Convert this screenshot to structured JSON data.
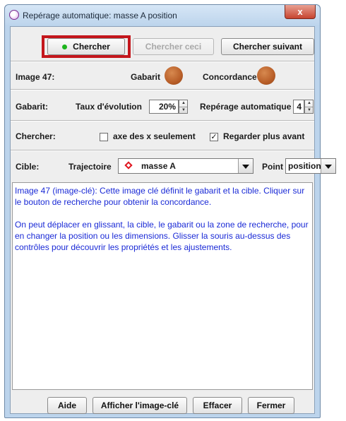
{
  "window": {
    "title": "Repérage automatique: masse A position",
    "close_label": "x"
  },
  "toolbar": {
    "search_label": "Chercher",
    "search_this_label": "Chercher ceci",
    "search_next_label": "Chercher suivant"
  },
  "image_row": {
    "label": "Image 47:",
    "template_label": "Gabarit",
    "match_label": "Concordance",
    "template_color": "#c06a30",
    "match_color": "#c06a30"
  },
  "template_row": {
    "label": "Gabarit:",
    "evolution_label": "Taux d'évolution",
    "evolution_value": "20%",
    "auto_label": "Repérage automatique",
    "auto_value": "4"
  },
  "search_row": {
    "label": "Chercher:",
    "x_axis_only_label": "axe des x seulement",
    "x_axis_only_checked": false,
    "look_ahead_label": "Regarder plus avant",
    "look_ahead_checked": true
  },
  "target_row": {
    "label": "Cible:",
    "trajectory_label": "Trajectoire",
    "trajectory_value": "masse A",
    "point_label": "Point",
    "point_value": "position",
    "marker_color": "#e0141e"
  },
  "info": {
    "paragraph1": "Image 47 (image-clé): Cette image clé définit le gabarit et la cible. Cliquer sur le bouton de recherche pour obtenir la concordance.",
    "paragraph2": "On peut déplacer en glissant, la cible, le gabarit ou la zone de recherche, pour en changer la position ou les dimensions.  Glisser la souris au-dessus des contrôles pour découvrir les propriétés et les ajustements.",
    "text_color": "#1a2ad6"
  },
  "footer": {
    "help_label": "Aide",
    "show_keyframe_label": "Afficher l'image-clé",
    "clear_label": "Effacer",
    "close_label": "Fermer"
  },
  "colors": {
    "highlight": "#c4161c",
    "active_dot": "#1db41d"
  }
}
